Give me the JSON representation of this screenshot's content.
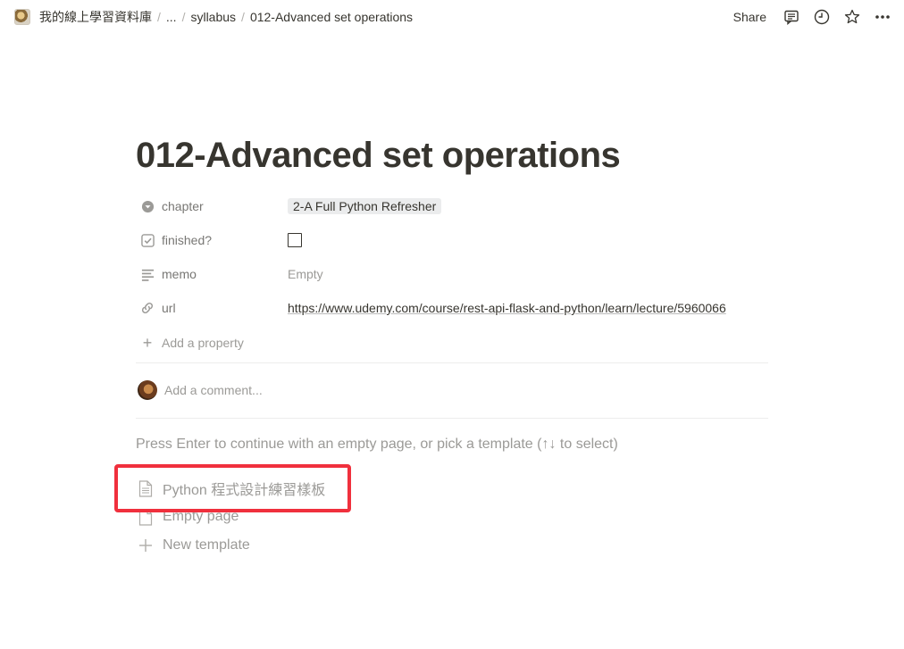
{
  "breadcrumb": {
    "workspace": "我的線上學習資料庫",
    "ellipsis": "...",
    "parent": "syllabus",
    "current": "012-Advanced set operations",
    "separator": "/"
  },
  "header": {
    "share_label": "Share",
    "icons": [
      "comment-icon",
      "clock-icon",
      "star-icon",
      "more-icon"
    ]
  },
  "page": {
    "title": "012-Advanced set operations",
    "properties": [
      {
        "icon": "select-icon",
        "name": "chapter",
        "type": "select",
        "value": "2-A Full Python Refresher"
      },
      {
        "icon": "checkbox-icon",
        "name": "finished?",
        "type": "checkbox",
        "value": false
      },
      {
        "icon": "text-icon",
        "name": "memo",
        "type": "text",
        "value": "Empty"
      },
      {
        "icon": "link-icon",
        "name": "url",
        "type": "url",
        "value": "https://www.udemy.com/course/rest-api-flask-and-python/learn/lecture/5960066"
      }
    ],
    "add_property_label": "Add a property",
    "comment_placeholder": "Add a comment...",
    "template_hint": "Press Enter to continue with an empty page, or pick a template (↑↓ to select)",
    "templates": [
      {
        "icon": "page-icon",
        "label": "Python 程式設計練習樣板"
      },
      {
        "icon": "empty-page-icon",
        "label": "Empty page"
      },
      {
        "icon": "plus-icon",
        "label": "New template"
      }
    ]
  },
  "annotation": {
    "color": "#f0303d"
  }
}
